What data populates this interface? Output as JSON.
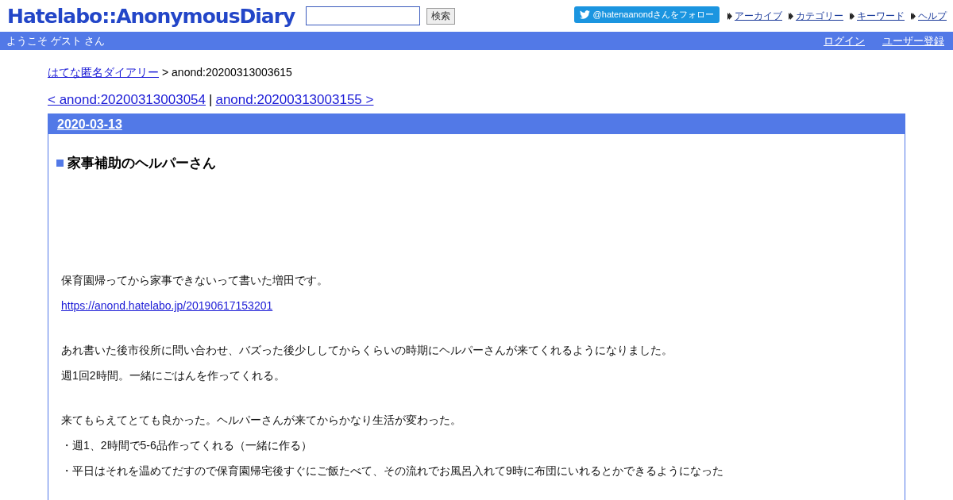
{
  "header": {
    "logo": "Hatelabo::AnonymousDiary",
    "search": {
      "button": "検索"
    },
    "follow_button": "@hatenaanondさんをフォロー",
    "nav": [
      "アーカイブ",
      "カテゴリー",
      "キーワード",
      "ヘルプ"
    ]
  },
  "userbar": {
    "welcome": "ようこそ ゲスト さん",
    "links": [
      "ログイン",
      "ユーザー登録"
    ]
  },
  "breadcrumb": {
    "link": "はてな匿名ダイアリー",
    "current": "> anond:20200313003615"
  },
  "pager": {
    "prev": "< anond:20200313003054",
    "separator": "|",
    "next": "anond:20200313003155 >"
  },
  "entry": {
    "date": "2020-03-13",
    "title": "家事補助のヘルパーさん",
    "sections": [
      [
        {
          "kind": "text",
          "text": "保育園帰ってから家事できないって書いた増田です。"
        },
        {
          "kind": "link",
          "text": "https://anond.hatelabo.jp/20190617153201"
        }
      ],
      [
        {
          "kind": "text",
          "text": "あれ書いた後市役所に問い合わせ、バズった後少ししてからくらいの時期にヘルパーさんが来てくれるようになりました。"
        },
        {
          "kind": "text",
          "text": "週1回2時間。一緒にごはんを作ってくれる。"
        }
      ],
      [
        {
          "kind": "text",
          "text": "来てもらえてとても良かった。ヘルパーさんが来てからかなり生活が変わった。"
        },
        {
          "kind": "text",
          "text": "・週1、2時間で5-6品作ってくれる（一緒に作る）"
        },
        {
          "kind": "text",
          "text": "・平日はそれを温めてだすので保育園帰宅後すぐにご飯たべて、その流れでお風呂入れて9時に布団にいれるとかできるようになった"
        }
      ]
    ]
  }
}
